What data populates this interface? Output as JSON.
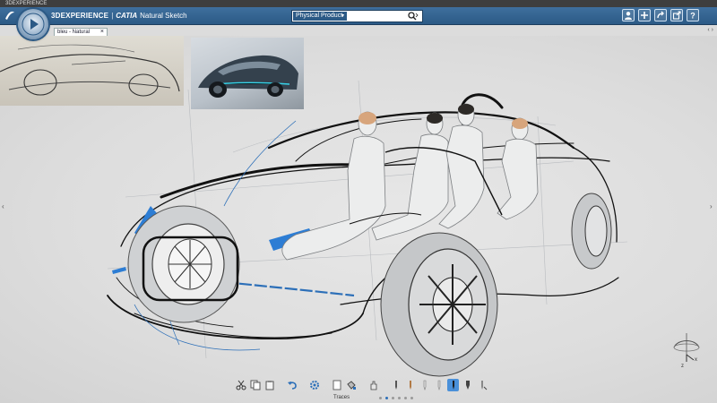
{
  "os_window": {
    "title": "3DEXPERIENCE"
  },
  "app": {
    "brand": "3DEXPERIENCE",
    "separator": "|",
    "product": "CATIA",
    "app_name": "Natural Sketch"
  },
  "search": {
    "scope": "Physical Product",
    "value": "",
    "placeholder": ""
  },
  "top_icons": [
    "user-icon",
    "add-icon",
    "share-icon",
    "export-icon",
    "help-icon"
  ],
  "tab": {
    "label": "bleu - Natural Sketch",
    "close": "×"
  },
  "tab_nav": "‹ ›",
  "side_nav": {
    "left": "‹",
    "right": "›"
  },
  "toolbar": {
    "section_label": "Traces",
    "pager_dots": 6,
    "pager_active": 1,
    "icons": [
      "scissors-icon",
      "copy-icon",
      "paste-icon",
      "undo-icon",
      "settings-icon",
      "page-icon",
      "bucket-icon",
      "hand-icon",
      "marker-icon",
      "pen-icon",
      "pencil-icon",
      "ink-icon",
      "brush-icon",
      "pen-nib-icon",
      "eraser-icon"
    ],
    "active_icon": "brush-icon"
  },
  "colors": {
    "header": "#2c5a86",
    "accent": "#4a90d9",
    "canvas": "#dedede",
    "sketch_blue": "#2c6fb8"
  }
}
